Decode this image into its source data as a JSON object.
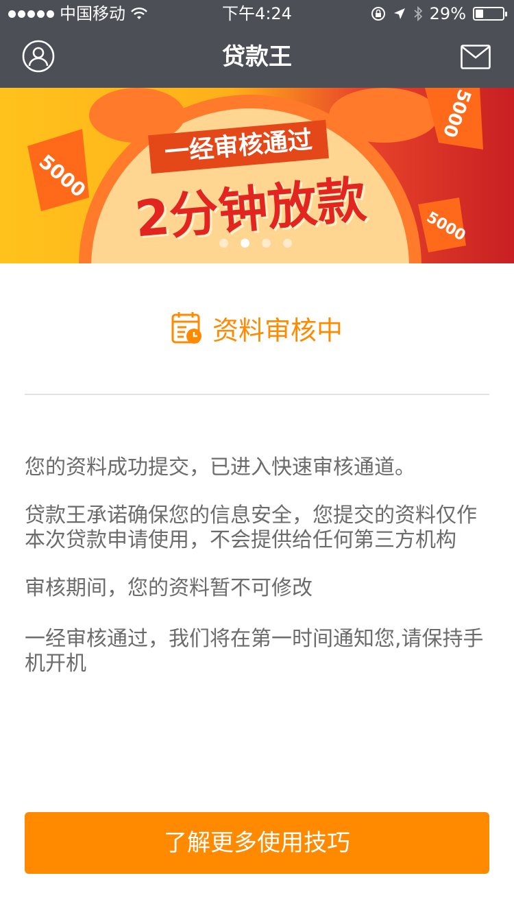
{
  "status_bar": {
    "carrier": "中国移动",
    "time": "下午4:24",
    "battery_percent": "29%",
    "battery_level": 0.29
  },
  "nav": {
    "title": "贷款王",
    "left_icon": "user-icon",
    "right_icon": "mail-icon"
  },
  "banner": {
    "line1": "一经审核通过",
    "line2": "2分钟放款",
    "badge": "5000",
    "pager_count": 4,
    "pager_active_index": 1
  },
  "review": {
    "icon": "calendar-clock-icon",
    "title": "资料审核中"
  },
  "paragraphs": [
    "您的资料成功提交，已进入快速审核通道。",
    "贷款王承诺确保您的信息安全，您提交的资料仅作本次贷款申请使用，不会提供给任何第三方机构",
    "审核期间，您的资料暂不可修改",
    "一经审核通过，我们将在第一时间通知您,请保持手机开机"
  ],
  "cta": {
    "label": "了解更多使用技巧"
  },
  "colors": {
    "accent": "#ff8a00",
    "topbar": "#4c4f56",
    "text": "#6b6b6b"
  }
}
